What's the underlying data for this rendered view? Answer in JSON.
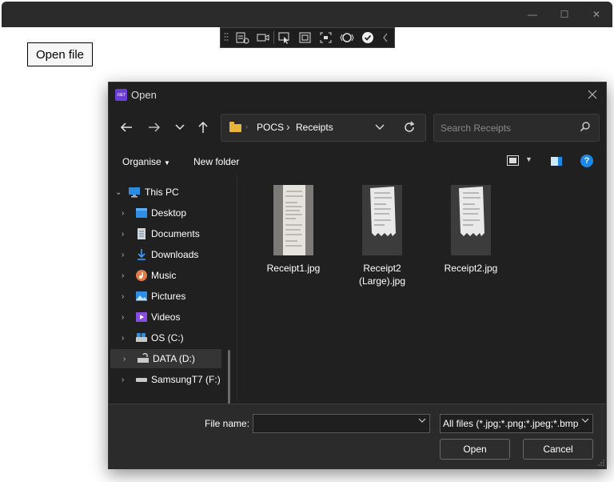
{
  "app": {
    "open_file_label": "Open file",
    "window_controls": {
      "minimize": "—",
      "maximize": "☐",
      "close": "✕"
    }
  },
  "debug_toolbar": {
    "icons": [
      "select-element-icon",
      "video-icon",
      "pointer-icon",
      "layout-adorner-icon",
      "track-focus-icon",
      "binding-failures-icon",
      "accessibility-check-icon",
      "collapse-chevron-icon"
    ]
  },
  "dialog": {
    "badge": ".NET",
    "title": "Open",
    "address": {
      "parent": "POCS",
      "separator": "›",
      "current": "Receipts"
    },
    "search_placeholder": "Search Receipts",
    "toolbar": {
      "organise": "Organise",
      "new_folder": "New folder"
    },
    "nav": [
      {
        "label": "This PC",
        "icon": "computer-icon",
        "expanded": true,
        "level": 0
      },
      {
        "label": "Desktop",
        "icon": "desktop-icon",
        "level": 1
      },
      {
        "label": "Documents",
        "icon": "documents-icon",
        "level": 1
      },
      {
        "label": "Downloads",
        "icon": "downloads-icon",
        "level": 1
      },
      {
        "label": "Music",
        "icon": "music-icon",
        "level": 1
      },
      {
        "label": "Pictures",
        "icon": "pictures-icon",
        "level": 1
      },
      {
        "label": "Videos",
        "icon": "videos-icon",
        "level": 1
      },
      {
        "label": "OS (C:)",
        "icon": "os-drive-icon",
        "level": 1
      },
      {
        "label": "DATA (D:)",
        "icon": "data-drive-icon",
        "level": 1,
        "selected": true
      },
      {
        "label": "SamsungT7 (F:)",
        "icon": "external-drive-icon",
        "level": 1
      }
    ],
    "files": [
      {
        "name": "Receipt1.jpg"
      },
      {
        "name": "Receipt2 (Large).jpg"
      },
      {
        "name": "Receipt2.jpg"
      }
    ],
    "footer": {
      "file_name_label": "File name:",
      "file_name_value": "",
      "filter": "All files (*.jpg;*.png;*.jpeg;*.bmp)",
      "open_label": "Open",
      "cancel_label": "Cancel"
    }
  },
  "colors": {
    "dialog_bg": "#202020",
    "accent": "#1e88e5",
    "folder": "#e8b43a",
    "badge": "#6b3fd6"
  }
}
